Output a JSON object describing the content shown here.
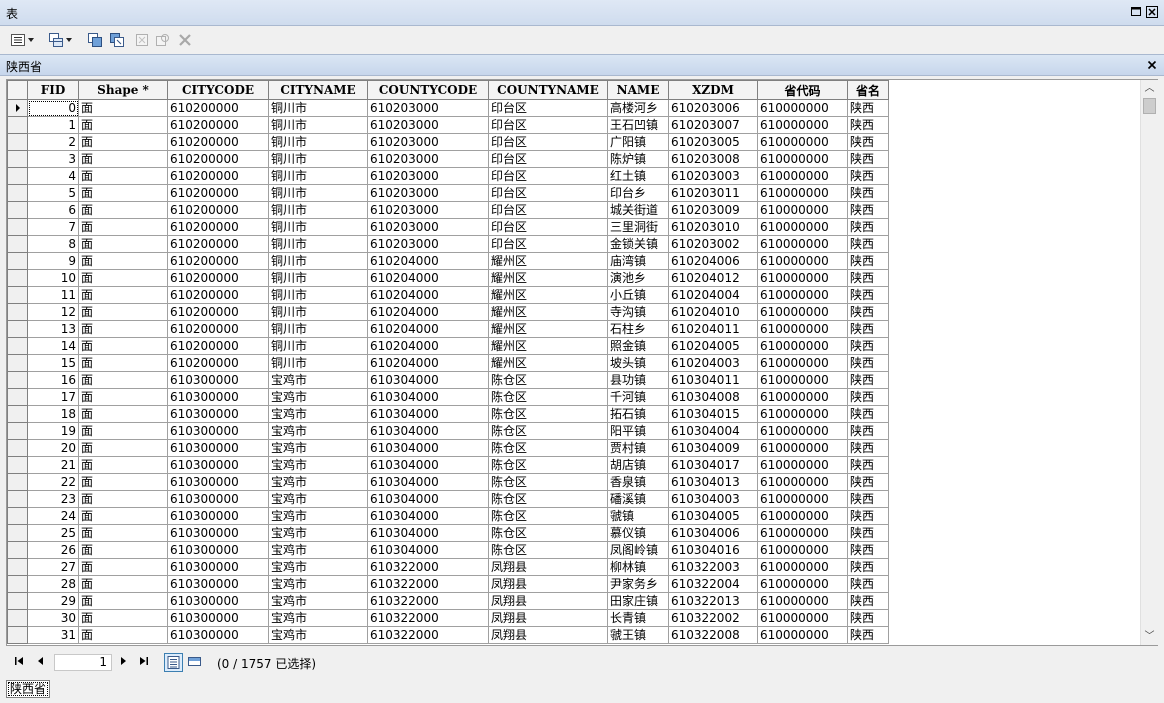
{
  "window": {
    "title": "表"
  },
  "table_tab": {
    "name": "陕西省"
  },
  "columns": [
    "FID",
    "Shape *",
    "CITYCODE",
    "CITYNAME",
    "COUNTYCODE",
    "COUNTYNAME",
    "NAME",
    "XZDM",
    "省代码",
    "省名"
  ],
  "rows": [
    [
      "0",
      "面",
      "610200000",
      "铜川市",
      "610203000",
      "印台区",
      "高楼河乡",
      "610203006",
      "610000000",
      "陕西"
    ],
    [
      "1",
      "面",
      "610200000",
      "铜川市",
      "610203000",
      "印台区",
      "王石凹镇",
      "610203007",
      "610000000",
      "陕西"
    ],
    [
      "2",
      "面",
      "610200000",
      "铜川市",
      "610203000",
      "印台区",
      "广阳镇",
      "610203005",
      "610000000",
      "陕西"
    ],
    [
      "3",
      "面",
      "610200000",
      "铜川市",
      "610203000",
      "印台区",
      "陈炉镇",
      "610203008",
      "610000000",
      "陕西"
    ],
    [
      "4",
      "面",
      "610200000",
      "铜川市",
      "610203000",
      "印台区",
      "红土镇",
      "610203003",
      "610000000",
      "陕西"
    ],
    [
      "5",
      "面",
      "610200000",
      "铜川市",
      "610203000",
      "印台区",
      "印台乡",
      "610203011",
      "610000000",
      "陕西"
    ],
    [
      "6",
      "面",
      "610200000",
      "铜川市",
      "610203000",
      "印台区",
      "城关街道",
      "610203009",
      "610000000",
      "陕西"
    ],
    [
      "7",
      "面",
      "610200000",
      "铜川市",
      "610203000",
      "印台区",
      "三里洞街",
      "610203010",
      "610000000",
      "陕西"
    ],
    [
      "8",
      "面",
      "610200000",
      "铜川市",
      "610203000",
      "印台区",
      "金锁关镇",
      "610203002",
      "610000000",
      "陕西"
    ],
    [
      "9",
      "面",
      "610200000",
      "铜川市",
      "610204000",
      "耀州区",
      "庙湾镇",
      "610204006",
      "610000000",
      "陕西"
    ],
    [
      "10",
      "面",
      "610200000",
      "铜川市",
      "610204000",
      "耀州区",
      "演池乡",
      "610204012",
      "610000000",
      "陕西"
    ],
    [
      "11",
      "面",
      "610200000",
      "铜川市",
      "610204000",
      "耀州区",
      "小丘镇",
      "610204004",
      "610000000",
      "陕西"
    ],
    [
      "12",
      "面",
      "610200000",
      "铜川市",
      "610204000",
      "耀州区",
      "寺沟镇",
      "610204010",
      "610000000",
      "陕西"
    ],
    [
      "13",
      "面",
      "610200000",
      "铜川市",
      "610204000",
      "耀州区",
      "石柱乡",
      "610204011",
      "610000000",
      "陕西"
    ],
    [
      "14",
      "面",
      "610200000",
      "铜川市",
      "610204000",
      "耀州区",
      "照金镇",
      "610204005",
      "610000000",
      "陕西"
    ],
    [
      "15",
      "面",
      "610200000",
      "铜川市",
      "610204000",
      "耀州区",
      "坡头镇",
      "610204003",
      "610000000",
      "陕西"
    ],
    [
      "16",
      "面",
      "610300000",
      "宝鸡市",
      "610304000",
      "陈仓区",
      "县功镇",
      "610304011",
      "610000000",
      "陕西"
    ],
    [
      "17",
      "面",
      "610300000",
      "宝鸡市",
      "610304000",
      "陈仓区",
      "千河镇",
      "610304008",
      "610000000",
      "陕西"
    ],
    [
      "18",
      "面",
      "610300000",
      "宝鸡市",
      "610304000",
      "陈仓区",
      "拓石镇",
      "610304015",
      "610000000",
      "陕西"
    ],
    [
      "19",
      "面",
      "610300000",
      "宝鸡市",
      "610304000",
      "陈仓区",
      "阳平镇",
      "610304004",
      "610000000",
      "陕西"
    ],
    [
      "20",
      "面",
      "610300000",
      "宝鸡市",
      "610304000",
      "陈仓区",
      "贾村镇",
      "610304009",
      "610000000",
      "陕西"
    ],
    [
      "21",
      "面",
      "610300000",
      "宝鸡市",
      "610304000",
      "陈仓区",
      "胡店镇",
      "610304017",
      "610000000",
      "陕西"
    ],
    [
      "22",
      "面",
      "610300000",
      "宝鸡市",
      "610304000",
      "陈仓区",
      "香泉镇",
      "610304013",
      "610000000",
      "陕西"
    ],
    [
      "23",
      "面",
      "610300000",
      "宝鸡市",
      "610304000",
      "陈仓区",
      "磻溪镇",
      "610304003",
      "610000000",
      "陕西"
    ],
    [
      "24",
      "面",
      "610300000",
      "宝鸡市",
      "610304000",
      "陈仓区",
      "虢镇",
      "610304005",
      "610000000",
      "陕西"
    ],
    [
      "25",
      "面",
      "610300000",
      "宝鸡市",
      "610304000",
      "陈仓区",
      "慕仪镇",
      "610304006",
      "610000000",
      "陕西"
    ],
    [
      "26",
      "面",
      "610300000",
      "宝鸡市",
      "610304000",
      "陈仓区",
      "凤阁岭镇",
      "610304016",
      "610000000",
      "陕西"
    ],
    [
      "27",
      "面",
      "610300000",
      "宝鸡市",
      "610322000",
      "凤翔县",
      "柳林镇",
      "610322003",
      "610000000",
      "陕西"
    ],
    [
      "28",
      "面",
      "610300000",
      "宝鸡市",
      "610322000",
      "凤翔县",
      "尹家务乡",
      "610322004",
      "610000000",
      "陕西"
    ],
    [
      "29",
      "面",
      "610300000",
      "宝鸡市",
      "610322000",
      "凤翔县",
      "田家庄镇",
      "610322013",
      "610000000",
      "陕西"
    ],
    [
      "30",
      "面",
      "610300000",
      "宝鸡市",
      "610322000",
      "凤翔县",
      "长青镇",
      "610322002",
      "610000000",
      "陕西"
    ],
    [
      "31",
      "面",
      "610300000",
      "宝鸡市",
      "610322000",
      "凤翔县",
      "虢王镇",
      "610322008",
      "610000000",
      "陕西"
    ]
  ],
  "status": {
    "current_record": "1",
    "selection_text": "(0 / 1757 已选择)"
  },
  "bottom_tab": {
    "label": "陕西省"
  }
}
